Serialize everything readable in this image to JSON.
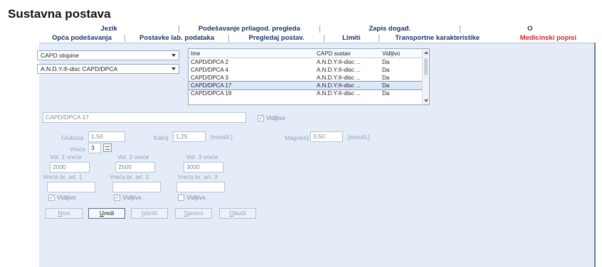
{
  "title": "Sustavna postava",
  "tabs_top": [
    "Jezik",
    "Podešavanje prilagod. pregleda",
    "Zapis događ.",
    "O"
  ],
  "tabs_bottom": [
    "Opća podešavanja",
    "Postavke lab. podataka",
    "Pregledaj postav.",
    "Limiti",
    "Transportne karakteristike",
    "Medicinski popisi"
  ],
  "active_tab": "Medicinski popisi",
  "colors": {
    "active_tab": "#d8232a",
    "tab_text": "#1d3566",
    "panel_bg": "#e3ecf7"
  },
  "combo1": "CAPD otopine",
  "combo2": "A.N.D.Y.®-disc CAPD/DPCA",
  "list": {
    "headers": [
      "Ime",
      "CAPD sustav",
      "Vidljivo"
    ],
    "rows": [
      [
        "CAPD/DPCA 2",
        "A.N.D.Y.®-disc ...",
        "Da"
      ],
      [
        "CAPD/DPCA 4",
        "A.N.D.Y.®-disc ...",
        "Da"
      ],
      [
        "CAPD/DPCA 3",
        "A.N.D.Y.®-disc ...",
        "Da"
      ],
      [
        "CAPD/DPCA 17",
        "A.N.D.Y.®-disc ...",
        "Da"
      ],
      [
        "CAPD/DPCA 19",
        "A.N.D.Y.®-disc ...",
        "Da"
      ]
    ],
    "selected_index": 3
  },
  "form": {
    "name_value": "CAPD/DPCA 17",
    "visible_label": "Vidljivo",
    "glucose_label": "Glukoza",
    "glucose_value": "1,50",
    "calcium_label": "Kalcij",
    "calcium_value": "1,25",
    "calcium_unit": "[mmol/L]",
    "magnesium_label": "Magnezij",
    "magnesium_value": "0,50",
    "magnesium_unit": "[mmol/L]",
    "bags_label": "Vreće",
    "bags_value": "3",
    "vol1_label": "Vol. 1 vreće",
    "vol1_value": "2000",
    "vol2_label": "Vol. 2 vreće",
    "vol2_value": "2500",
    "vol3_label": "Vol. 3 vreće",
    "vol3_value": "3000",
    "art1_label": "Vreća br. art. 1",
    "art2_label": "Vreća br. art. 2",
    "art3_label": "Vreća br. art. 3",
    "art1_value": "",
    "art2_value": "",
    "art3_value": "",
    "vis1_label": "Vidljivo",
    "vis2_label": "Vidljivo",
    "vis3_label": "Vidljivo"
  },
  "buttons": {
    "new_first": "N",
    "new_rest": "ovi",
    "edit_first": "U",
    "edit_rest": "redi",
    "delete_first": "I",
    "delete_rest": "zbriši",
    "save_first": "S",
    "save_rest": "premi",
    "cancel_first": "O",
    "cancel_rest": "tkaži"
  }
}
